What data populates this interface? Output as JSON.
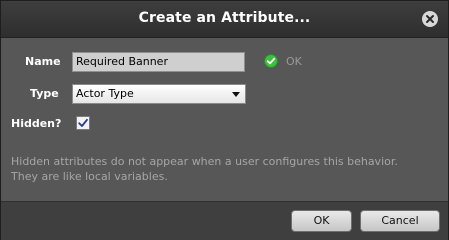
{
  "dialog": {
    "title": "Create an Attribute...",
    "close_icon": "close-icon"
  },
  "form": {
    "name_label": "Name",
    "name_value": "Required Banner",
    "name_status": {
      "icon": "check-circle-icon",
      "text": "OK",
      "color": "#3fbf3f"
    },
    "type_label": "Type",
    "type_value": "Actor Type",
    "hidden_label": "Hidden?",
    "hidden_checked": true
  },
  "hint": {
    "line1": "Hidden attributes do not appear when a user configures this behavior.",
    "line2": "They are like local variables."
  },
  "footer": {
    "ok_label": "OK",
    "cancel_label": "Cancel"
  }
}
